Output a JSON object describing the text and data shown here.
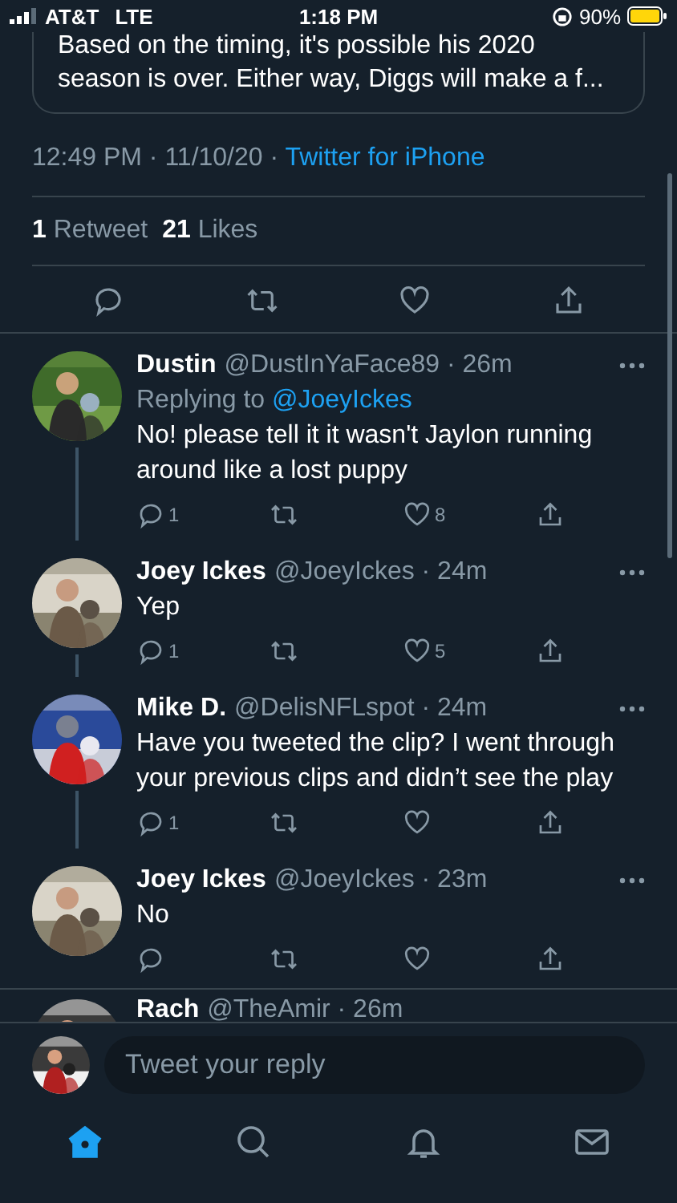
{
  "status_bar": {
    "carrier": "AT&T",
    "network": "LTE",
    "time": "1:18 PM",
    "battery": "90%"
  },
  "quoted_tweet": {
    "lines": [
      "Based on the timing, it's possible his 2020",
      "season is over. Either way, Diggs will make a f..."
    ]
  },
  "tweet_meta": {
    "timestamp": "12:49 PM · 11/10/20 ·",
    "source": "Twitter for iPhone"
  },
  "stats": [
    {
      "count": "1",
      "label": "Retweet"
    },
    {
      "count": "21",
      "label": "Likes"
    }
  ],
  "replies": [
    {
      "name": "Dustin",
      "handle": "@DustInYaFace89 · 26m",
      "replying_to_label": "Replying to",
      "replying_to": "@JoeyIckes",
      "text": "No! please tell it it wasn't Jaylon running around like a lost puppy",
      "reply_count": "1",
      "like_count": "8",
      "thread_continues": true
    },
    {
      "name": "Joey Ickes",
      "handle": "@JoeyIckes · 24m",
      "text": "Yep",
      "reply_count": "1",
      "like_count": "5",
      "thread_continues": true
    },
    {
      "name": "Mike D.",
      "handle": "@DelisNFLspot · 24m",
      "text": "Have you tweeted the clip? I went through your previous clips and didn’t see the play",
      "reply_count": "1",
      "thread_continues": true
    },
    {
      "name": "Joey Ickes",
      "handle": "@JoeyIckes · 23m",
      "text": "No",
      "thread_continues": false
    }
  ],
  "partial_reply": {
    "name": "Rach",
    "handle": "@TheAmir · 26m"
  },
  "reply_box": {
    "placeholder": "Tweet your reply"
  },
  "tab_bar": [
    {
      "kind": "home",
      "selected": true
    },
    {
      "kind": "search",
      "selected": false
    },
    {
      "kind": "notifications",
      "selected": false
    },
    {
      "kind": "messages",
      "selected": false
    }
  ]
}
